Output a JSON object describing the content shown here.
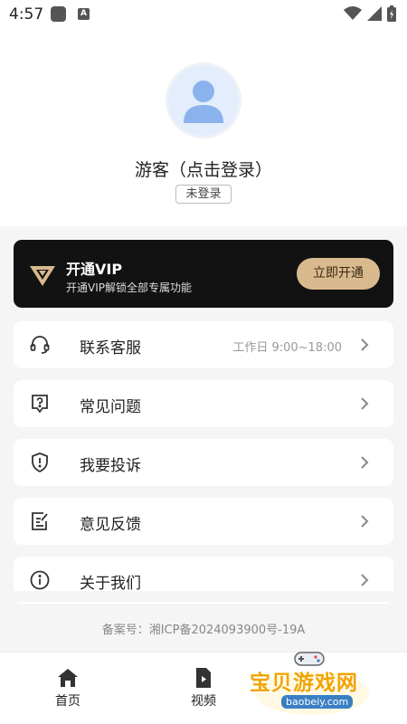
{
  "status_bar": {
    "time": "4:57",
    "app_icon_2": "A"
  },
  "profile": {
    "username": "游客（点击登录）",
    "login_status": "未登录"
  },
  "vip": {
    "title": "开通VIP",
    "subtitle": "开通VIP解锁全部专属功能",
    "button": "立即开通"
  },
  "menu": [
    {
      "icon": "headset-icon",
      "label": "联系客服",
      "extra": "工作日 9:00~18:00"
    },
    {
      "icon": "question-icon",
      "label": "常见问题",
      "extra": ""
    },
    {
      "icon": "shield-alert-icon",
      "label": "我要投诉",
      "extra": ""
    },
    {
      "icon": "feedback-edit-icon",
      "label": "意见反馈",
      "extra": ""
    },
    {
      "icon": "info-icon",
      "label": "关于我们",
      "extra": ""
    }
  ],
  "footer": {
    "icp": "备案号：湘ICP备2024093900号-19A"
  },
  "tabbar": {
    "home": "首页",
    "video": "视频"
  },
  "watermark": {
    "text": "宝贝游戏网",
    "url": "baobeiy.com"
  },
  "colors": {
    "vip_card": "#121212",
    "vip_button": "#d9ba8e",
    "background": "#f5f5f5",
    "watermark": "#f0a500"
  }
}
